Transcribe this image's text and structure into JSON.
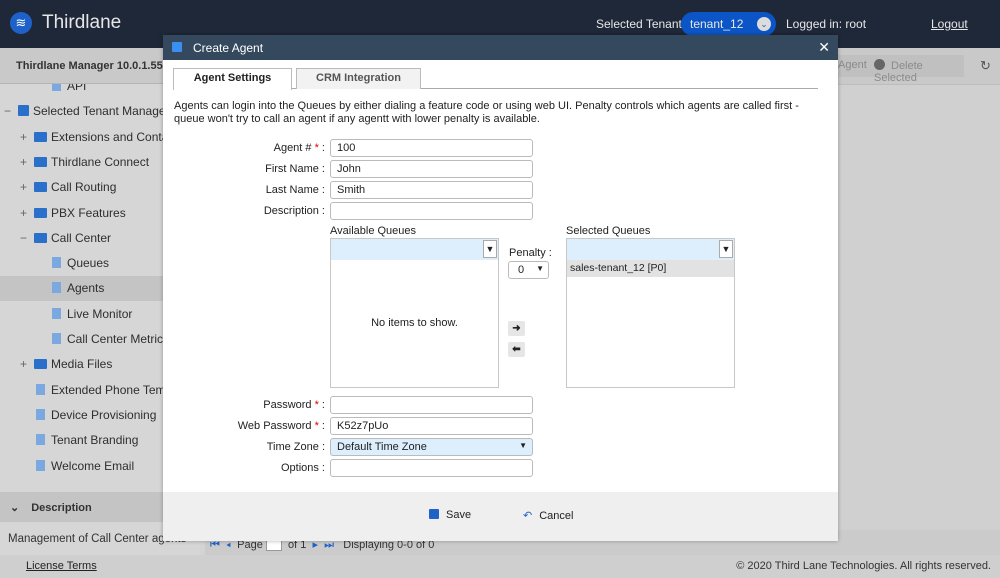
{
  "header": {
    "brand": "Thirdlane",
    "tenant_label": "Selected Tenant :",
    "tenant_value": "tenant_12",
    "logged_in": "Logged in: root",
    "logout": "Logout"
  },
  "version": "Thirdlane Manager 10.0.1.55",
  "toolbar": {
    "add_agent": "Agent",
    "delete_selected": "Delete Selected"
  },
  "sidebar": {
    "items": [
      {
        "label": "API",
        "type": "doc"
      },
      {
        "label": "Selected Tenant Manager",
        "type": "tenant",
        "toggle": "−"
      },
      {
        "label": "Extensions and Contacts",
        "type": "folder",
        "toggle": "+"
      },
      {
        "label": "Thirdlane Connect",
        "type": "folder",
        "toggle": "+"
      },
      {
        "label": "Call Routing",
        "type": "folder",
        "toggle": "+"
      },
      {
        "label": "PBX Features",
        "type": "folder",
        "toggle": "+"
      },
      {
        "label": "Call Center",
        "type": "folder",
        "toggle": "−"
      },
      {
        "label": "Queues",
        "type": "doc"
      },
      {
        "label": "Agents",
        "type": "doc",
        "selected": true
      },
      {
        "label": "Live Monitor",
        "type": "doc"
      },
      {
        "label": "Call Center Metrics",
        "type": "doc"
      },
      {
        "label": "Media Files",
        "type": "folder",
        "toggle": "+"
      },
      {
        "label": "Extended Phone Templates",
        "type": "doc"
      },
      {
        "label": "Device Provisioning",
        "type": "doc"
      },
      {
        "label": "Tenant Branding",
        "type": "doc"
      },
      {
        "label": "Welcome Email",
        "type": "doc"
      }
    ]
  },
  "description": {
    "title": "Description",
    "text": "Management of Call Center agents"
  },
  "pager": {
    "page": "Page",
    "of": "of 1",
    "displaying": "Displaying 0-0 of 0"
  },
  "footer": {
    "license": "License Terms",
    "copyright": "© 2020 Third Lane Technologies. All rights reserved."
  },
  "modal": {
    "title": "Create Agent",
    "tabs": [
      "Agent Settings",
      "CRM Integration"
    ],
    "intro": "Agents can login into the Queues by either dialing a feature code or using web UI. Penalty controls which agents are called first - queue won't try to call an agent if any agentt with lower penalty is available.",
    "fields": {
      "agent_no": {
        "label": "Agent #",
        "value": "100"
      },
      "first_name": {
        "label": "First Name :",
        "value": "John"
      },
      "last_name": {
        "label": "Last Name :",
        "value": "Smith"
      },
      "description": {
        "label": "Description :",
        "value": ""
      },
      "password": {
        "label": "Password",
        "value": ""
      },
      "web_password": {
        "label": "Web Password",
        "value": "K52z7pUo"
      },
      "time_zone": {
        "label": "Time Zone :",
        "value": "Default Time Zone"
      },
      "options": {
        "label": "Options :",
        "value": ""
      }
    },
    "available_queues": {
      "title": "Available Queues",
      "empty": "No items to show."
    },
    "selected_queues": {
      "title": "Selected Queues",
      "items": [
        "sales-tenant_12 [P0]"
      ]
    },
    "penalty": {
      "label": "Penalty :",
      "value": "0"
    },
    "save": "Save",
    "cancel": "Cancel"
  },
  "colors": {
    "header": "#1f2839",
    "modal_header": "#34495e",
    "accent": "#0b55c7"
  }
}
